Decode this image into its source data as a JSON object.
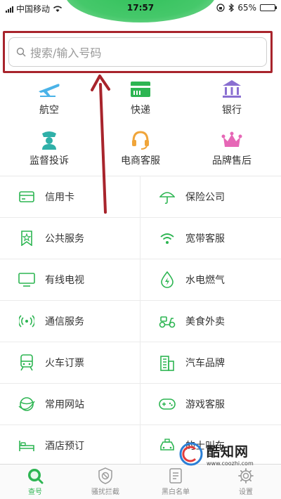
{
  "status_bar": {
    "carrier": "中国移动",
    "time": "17:57",
    "battery": "65%",
    "battery_level": 0.65
  },
  "search": {
    "placeholder": "搜索/输入号码"
  },
  "top_grid": [
    {
      "label": "航空",
      "icon": "airplane-icon",
      "color": "#4ab3e8"
    },
    {
      "label": "快递",
      "icon": "delivery-icon",
      "color": "#2db552"
    },
    {
      "label": "银行",
      "icon": "bank-icon",
      "color": "#8a6fd1"
    },
    {
      "label": "监督投诉",
      "icon": "police-icon",
      "color": "#2fb0a8"
    },
    {
      "label": "电商客服",
      "icon": "headset-icon",
      "color": "#f0a53a"
    },
    {
      "label": "品牌售后",
      "icon": "crown-icon",
      "color": "#e667b6"
    }
  ],
  "list": [
    {
      "label": "信用卡",
      "icon": "credit-card-icon"
    },
    {
      "label": "保险公司",
      "icon": "umbrella-icon"
    },
    {
      "label": "公共服务",
      "icon": "star-bookmark-icon"
    },
    {
      "label": "宽带客服",
      "icon": "wifi-icon"
    },
    {
      "label": "有线电视",
      "icon": "tv-icon"
    },
    {
      "label": "水电燃气",
      "icon": "water-drop-icon"
    },
    {
      "label": "通信服务",
      "icon": "signal-tower-icon"
    },
    {
      "label": "美食外卖",
      "icon": "scooter-icon"
    },
    {
      "label": "火车订票",
      "icon": "train-icon"
    },
    {
      "label": "汽车品牌",
      "icon": "building-icon"
    },
    {
      "label": "常用网站",
      "icon": "globe-icon"
    },
    {
      "label": "游戏客服",
      "icon": "gamepad-icon"
    },
    {
      "label": "酒店预订",
      "icon": "bed-icon"
    },
    {
      "label": "的士叫车",
      "icon": "taxi-icon"
    }
  ],
  "tabbar": [
    {
      "label": "查号",
      "icon": "search-tab-icon",
      "active": true
    },
    {
      "label": "骚扰拦截",
      "icon": "shield-block-icon",
      "active": false
    },
    {
      "label": "黑白名单",
      "icon": "list-icon",
      "active": false
    },
    {
      "label": "设置",
      "icon": "gear-icon",
      "active": false
    }
  ],
  "watermark": {
    "title": "酷知网",
    "url": "www.coozhi.com"
  },
  "colors": {
    "accent": "#2db552",
    "annotation_red": "#a8242c"
  }
}
